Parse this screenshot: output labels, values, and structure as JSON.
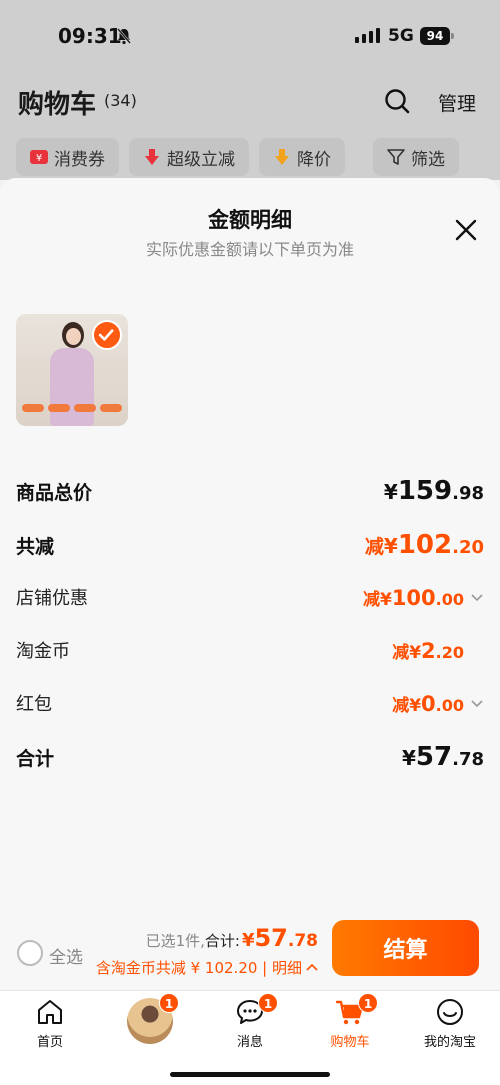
{
  "status_bar": {
    "time": "09:31",
    "network": "5G",
    "battery": "94"
  },
  "cart_header": {
    "title": "购物车",
    "count": "(34)",
    "manage_label": "管理",
    "chips": [
      {
        "icon": "coupon-icon",
        "label": "消费券"
      },
      {
        "icon": "arrow-down-icon",
        "label": "超级立减"
      },
      {
        "icon": "price-drop-icon",
        "label": "降价"
      },
      {
        "icon": "filter-icon",
        "label": "筛选"
      }
    ]
  },
  "sheet": {
    "title": "金额明细",
    "subtitle": "实际优惠金额请以下单页为准",
    "rows": {
      "total": {
        "label": "商品总价",
        "prefix": "",
        "currency": "¥",
        "integer": "159",
        "decimal": ".98"
      },
      "discount": {
        "label": "共减",
        "prefix": "减",
        "currency": "¥",
        "integer": "102",
        "decimal": ".20"
      },
      "shop": {
        "label": "店铺优惠",
        "prefix": "减",
        "currency": "¥",
        "integer": "100",
        "decimal": ".00"
      },
      "coins": {
        "label": "淘金币",
        "prefix": "减",
        "currency": "¥",
        "integer": "2",
        "decimal": ".20"
      },
      "redpacket": {
        "label": "红包",
        "prefix": "减",
        "currency": "¥",
        "integer": "0",
        "decimal": ".00"
      },
      "sum": {
        "label": "合计",
        "prefix": "",
        "currency": "¥",
        "integer": "57",
        "decimal": ".78"
      }
    }
  },
  "checkout": {
    "select_all": "全选",
    "selected_text": "已选1件,",
    "sum_label": "合计:",
    "currency": "¥",
    "integer": "57",
    "decimal": ".78",
    "saving_text": "含淘金币共减 ¥ 102.20 | 明细",
    "pay_label": "结算"
  },
  "tabbar": {
    "items": [
      {
        "icon": "home-icon",
        "label": "首页"
      },
      {
        "icon": "avatar",
        "label": "",
        "badge": "1"
      },
      {
        "icon": "message-icon",
        "label": "消息",
        "badge": "1"
      },
      {
        "icon": "cart-icon",
        "label": "购物车",
        "badge": "1"
      },
      {
        "icon": "profile-icon",
        "label": "我的淘宝"
      }
    ]
  },
  "colors": {
    "accent": "#ff5000",
    "overlay": "#cfcfcf"
  }
}
